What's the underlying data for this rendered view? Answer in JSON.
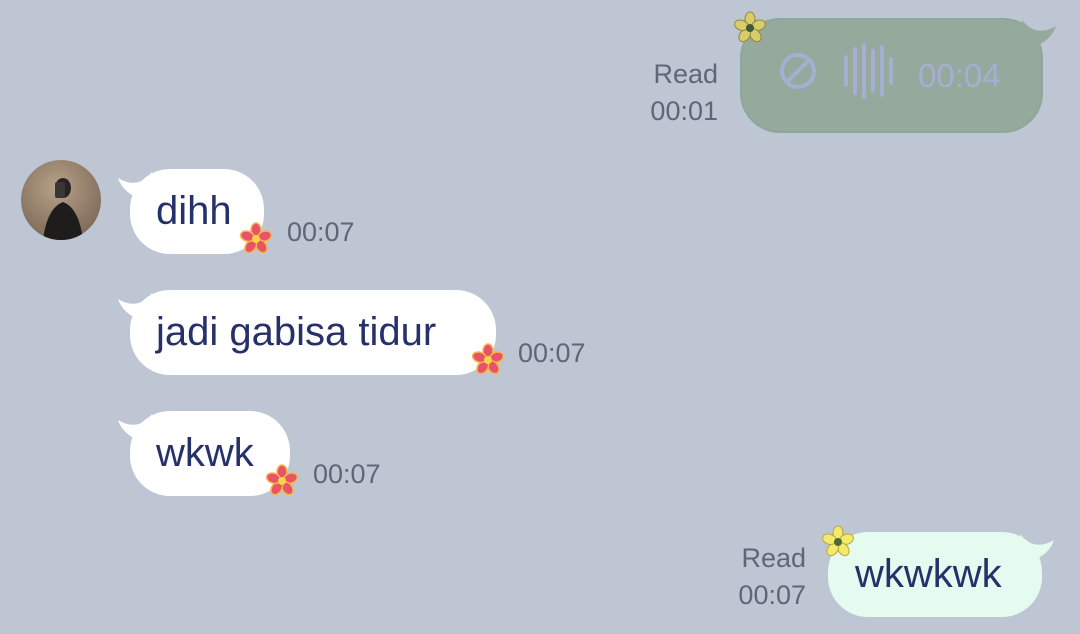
{
  "messages": [
    {
      "direction": "outgoing",
      "type": "voice",
      "duration": "00:04",
      "status": "Read",
      "time": "00:01"
    },
    {
      "direction": "incoming",
      "type": "text",
      "text": "dihh",
      "time": "00:07"
    },
    {
      "direction": "incoming",
      "type": "text",
      "text": "jadi gabisa tidur",
      "time": "00:07"
    },
    {
      "direction": "incoming",
      "type": "text",
      "text": "wkwk",
      "time": "00:07"
    },
    {
      "direction": "outgoing",
      "type": "text",
      "text": "wkwkwk",
      "status": "Read",
      "time": "00:07"
    }
  ],
  "colors": {
    "background": "#bec6d3",
    "incoming_bubble": "#ffffff",
    "outgoing_bubble": "#e6fbf0",
    "voice_bubble": "#95a99d",
    "text": "#263069",
    "meta": "#5f6677"
  },
  "icons": {
    "voice_blocked": "prohibited-icon",
    "voice_wave": "waveform-icon",
    "sticker": "flower-icon",
    "avatar": "avatar"
  }
}
